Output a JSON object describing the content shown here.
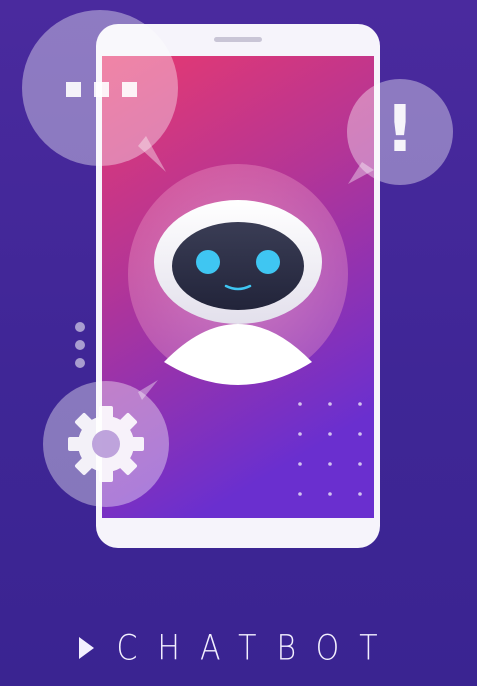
{
  "brand": {
    "title": "CHATBOT"
  },
  "icons": {
    "play": "play-triangle-icon",
    "typing": "typing-dots-bubble-icon",
    "alert": "exclamation-bubble-icon",
    "settings": "gear-bubble-icon",
    "robot": "robot-face-icon",
    "menu": "vertical-dots-icon",
    "pattern": "dot-grid-pattern"
  },
  "bubbles": {
    "alert_symbol": "!"
  },
  "colors": {
    "background": "#43289a",
    "screen_top": "#e43a72",
    "screen_bottom": "#6a2ed0",
    "robot_eye": "#3fc6f2",
    "phone_body": "#f6f4fb",
    "text": "#f3f0ff"
  }
}
